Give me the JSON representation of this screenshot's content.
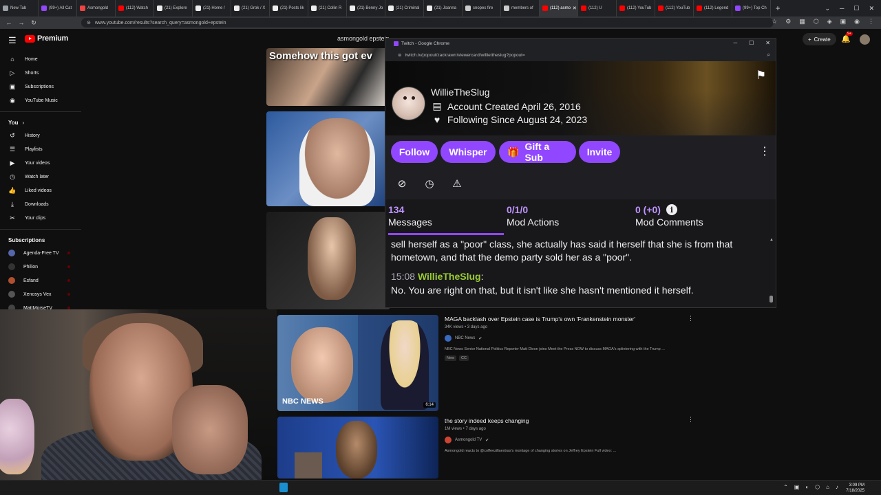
{
  "chrome": {
    "tabs": [
      {
        "label": "New Tab",
        "color": "#9aa0a6"
      },
      {
        "label": "(99+) All Cat",
        "color": "#9147ff"
      },
      {
        "label": "Asmongold",
        "color": "#e44"
      },
      {
        "label": "(112) Watch",
        "color": "#f00"
      },
      {
        "label": "(21) Explore",
        "color": "#eee"
      },
      {
        "label": "(21) Home /",
        "color": "#eee"
      },
      {
        "label": "(21) Grok / X",
        "color": "#eee"
      },
      {
        "label": "(21) Posts lik",
        "color": "#eee"
      },
      {
        "label": "(21) Collin R",
        "color": "#eee"
      },
      {
        "label": "(21) Benny Jo",
        "color": "#eee"
      },
      {
        "label": "(21) Criminal",
        "color": "#eee"
      },
      {
        "label": "(21) Joanna",
        "color": "#eee"
      },
      {
        "label": "snopes fire",
        "color": "#ccc"
      },
      {
        "label": "members of",
        "color": "#ccc"
      },
      {
        "label": "(112) asmo",
        "color": "#f00",
        "active": true
      },
      {
        "label": "(112) U",
        "color": "#f00"
      },
      {
        "label": "(112) YouTub",
        "color": "#f00"
      },
      {
        "label": "(112) YouTub",
        "color": "#f00"
      },
      {
        "label": "(112) Legend",
        "color": "#f00"
      },
      {
        "label": "(99+) Top Ch",
        "color": "#9147ff"
      }
    ],
    "address": "www.youtube.com/results?search_query=asmongold+epstein"
  },
  "youtube": {
    "logo_text": "Premium",
    "search_value": "asmongold epstein",
    "create_label": "Create",
    "notif_badge": "9+",
    "sidebar": {
      "main": [
        {
          "label": "Home",
          "icon": "home-icon",
          "glyph": "⌂"
        },
        {
          "label": "Shorts",
          "icon": "shorts-icon",
          "glyph": "▷"
        },
        {
          "label": "Subscriptions",
          "icon": "subscriptions-icon",
          "glyph": "▣"
        },
        {
          "label": "YouTube Music",
          "icon": "music-icon",
          "glyph": "◉"
        }
      ],
      "you_heading": "You",
      "you": [
        {
          "label": "History",
          "icon": "history-icon",
          "glyph": "↺"
        },
        {
          "label": "Playlists",
          "icon": "playlists-icon",
          "glyph": "☰"
        },
        {
          "label": "Your videos",
          "icon": "your-videos-icon",
          "glyph": "▶"
        },
        {
          "label": "Watch later",
          "icon": "watch-later-icon",
          "glyph": "◷"
        },
        {
          "label": "Liked videos",
          "icon": "like-icon",
          "glyph": "👍"
        },
        {
          "label": "Downloads",
          "icon": "download-icon",
          "glyph": "⤓"
        },
        {
          "label": "Your clips",
          "icon": "clips-icon",
          "glyph": "✂"
        }
      ],
      "subs_heading": "Subscriptions",
      "subs": [
        {
          "label": "Agenda-Free TV",
          "color": "#5566aa"
        },
        {
          "label": "Philion",
          "color": "#333333"
        },
        {
          "label": "Esfand",
          "color": "#b05030"
        },
        {
          "label": "Xenosys Vex",
          "color": "#555555"
        },
        {
          "label": "MattMorseTV",
          "color": "#444444"
        }
      ]
    },
    "thumb1_caption": "Somehow this got ev",
    "video1": {
      "title": "MAGA backlash over Epstein case is Trump's own 'Frankenstein monster'",
      "meta": "34K views • 3 days ago",
      "channel": "NBC News",
      "desc": "NBC News Senior National Politics Reporter Matt Dixon joins Meet the Press NOW to discuss MAGA's splintering with the Trump ...",
      "tags": [
        "New",
        "CC"
      ],
      "thumb_text": "NBC NEWS",
      "duration": "6:14"
    },
    "video2": {
      "title": "the story indeed keeps changing",
      "meta": "1M views • 7 days ago",
      "channel": "Asmongold TV",
      "desc": "Asmongold reacts to @coffeezillaextras's montage of changing stories on Jeffrey Epstein Full video: ..."
    }
  },
  "twitch": {
    "window_title": "Twitch - Google Chrome",
    "url": "twitch.tv/popout/zackrawrr/viewercard/williettheslug?popout=",
    "username": "WillieTheSlug",
    "account_created": "Account Created April 26, 2016",
    "following_since": "Following Since August 24, 2023",
    "buttons": {
      "follow": "Follow",
      "whisper": "Whisper",
      "gift": "Gift a Sub",
      "invite": "Invite"
    },
    "stats": {
      "messages_count": "134",
      "messages_label": "Messages",
      "mod_actions_count": "0/1/0",
      "mod_actions_label": "Mod Actions",
      "mod_comments_count": "0 (+0)",
      "mod_comments_label": "Mod Comments"
    },
    "chat": {
      "prev_text": "sell herself as a \"poor\" class, she actually has said it herself that she is from that hometown, and that the demo party sold her as a \"poor\".",
      "timestamp": "15:08",
      "user": "WillieTheSlug",
      "message": "No. You are right on that, but it isn't like she hasn't mentioned it herself."
    },
    "accent_color": "#9147ff"
  },
  "taskbar": {
    "time": "3:09 PM",
    "date": "7/18/2025"
  }
}
